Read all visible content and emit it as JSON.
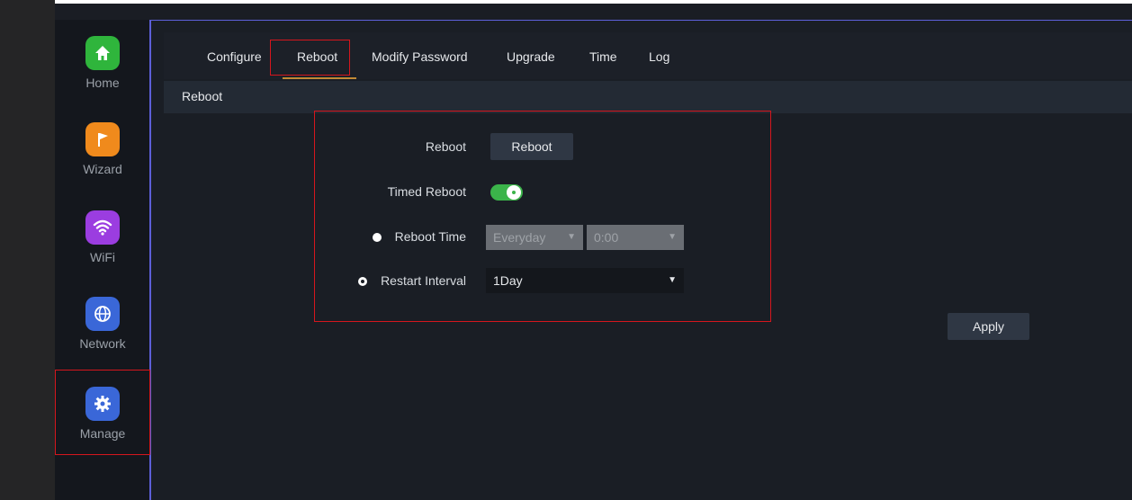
{
  "sidebar": {
    "items": [
      {
        "label": "Home",
        "icon": "home-icon",
        "color": "#2fb53c"
      },
      {
        "label": "Wizard",
        "icon": "flag-icon",
        "color": "#f08a1c"
      },
      {
        "label": "WiFi",
        "icon": "wifi-icon",
        "color": "#9b3de0"
      },
      {
        "label": "Network",
        "icon": "globe-icon",
        "color": "#3a67d8"
      },
      {
        "label": "Manage",
        "icon": "gear-icon",
        "color": "#3a67d8"
      }
    ],
    "active": "Manage"
  },
  "tabs": {
    "items": [
      "Configure",
      "Reboot",
      "Modify Password",
      "Upgrade",
      "Time",
      "Log"
    ],
    "active": "Reboot"
  },
  "section": {
    "title": "Reboot"
  },
  "form": {
    "reboot_label": "Reboot",
    "reboot_button": "Reboot",
    "timed_reboot_label": "Timed Reboot",
    "timed_reboot_enabled": true,
    "reboot_time_label": "Reboot Time",
    "reboot_time_day": "Everyday",
    "reboot_time_hour": "0:00",
    "restart_interval_label": "Restart Interval",
    "restart_interval_value": "1Day",
    "selected_mode": "Restart Interval"
  },
  "apply_button": "Apply",
  "colors": {
    "accent_underline": "#c28a35",
    "highlight_red": "#d5161d",
    "toggle_on": "#3bb44a",
    "border_purple": "#5d5fd8"
  }
}
